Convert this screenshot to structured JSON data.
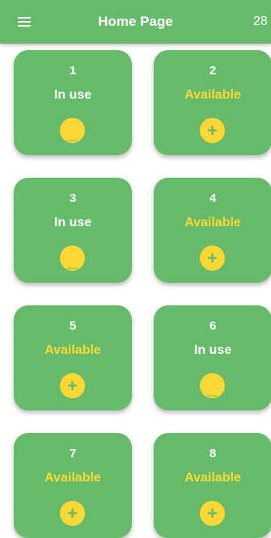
{
  "app_bar": {
    "title": "Home Page",
    "count": "28"
  },
  "colors": {
    "primary": "#66bb6a",
    "accent": "#fdd835",
    "in_use_text": "#ffffff",
    "available_text": "#fdd835"
  },
  "cards": [
    {
      "number": "1",
      "status": "In use",
      "in_use": true,
      "action_icon": "minus-icon",
      "action_glyph": "_"
    },
    {
      "number": "2",
      "status": "Available",
      "in_use": false,
      "action_icon": "plus-icon",
      "action_glyph": "+"
    },
    {
      "number": "3",
      "status": "In use",
      "in_use": true,
      "action_icon": "minus-icon",
      "action_glyph": "_"
    },
    {
      "number": "4",
      "status": "Available",
      "in_use": false,
      "action_icon": "plus-icon",
      "action_glyph": "+"
    },
    {
      "number": "5",
      "status": "Available",
      "in_use": false,
      "action_icon": "plus-icon",
      "action_glyph": "+"
    },
    {
      "number": "6",
      "status": "In use",
      "in_use": true,
      "action_icon": "minus-icon",
      "action_glyph": "_"
    },
    {
      "number": "7",
      "status": "Available",
      "in_use": false,
      "action_icon": "plus-icon",
      "action_glyph": "+"
    },
    {
      "number": "8",
      "status": "Available",
      "in_use": false,
      "action_icon": "plus-icon",
      "action_glyph": "+"
    }
  ]
}
